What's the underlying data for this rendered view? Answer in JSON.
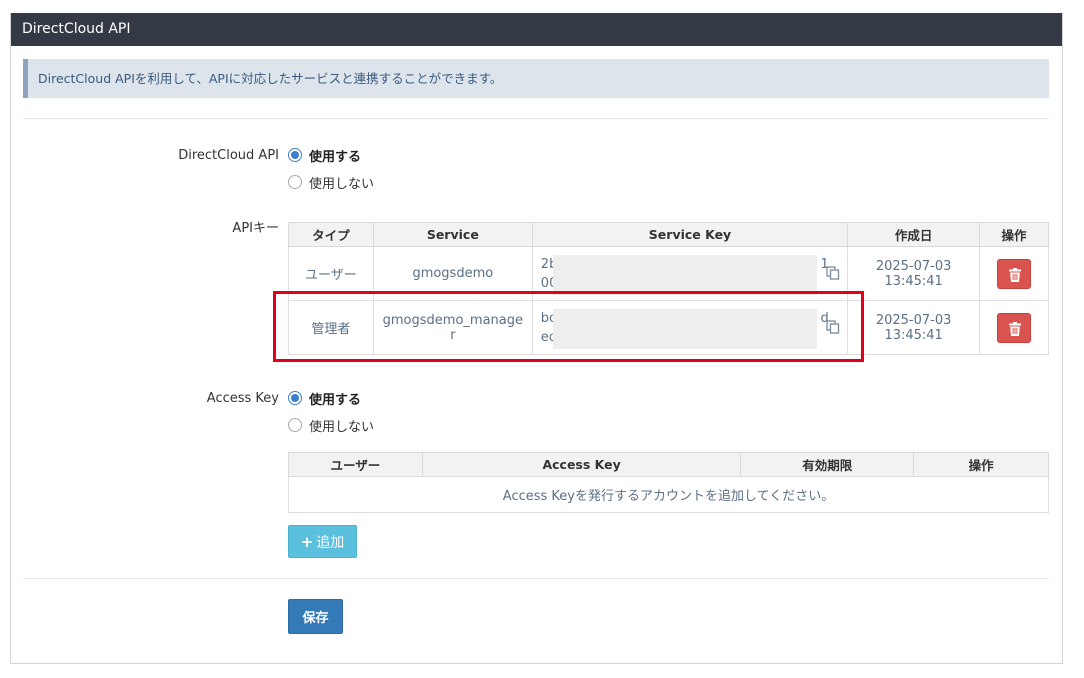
{
  "panel": {
    "title": "DirectCloud API"
  },
  "info": {
    "text": "DirectCloud APIを利用して、APIに対応したサービスと連携することができます。"
  },
  "directcloud_api": {
    "label": "DirectCloud API",
    "options": [
      {
        "label": "使用する",
        "checked": true
      },
      {
        "label": "使用しない",
        "checked": false
      }
    ]
  },
  "api_keys": {
    "label": "APIキー",
    "columns": [
      "タイプ",
      "Service",
      "Service Key",
      "作成日",
      "操作"
    ],
    "rows": [
      {
        "type": "ユーザー",
        "service": "gmogsdemo",
        "key_start": "2b",
        "key_end": "1",
        "key_start2": "00",
        "date": "2025-07-03",
        "time": "13:45:41"
      },
      {
        "type": "管理者",
        "service_line1": "gmogsdemo_manage",
        "service_line2": "r",
        "key_start": "bc",
        "key_end": "d",
        "key_start2": "ec",
        "date": "2025-07-03",
        "time": "13:45:41"
      }
    ]
  },
  "access_key": {
    "label": "Access Key",
    "options": [
      {
        "label": "使用する",
        "checked": true
      },
      {
        "label": "使用しない",
        "checked": false
      }
    ],
    "columns": [
      "ユーザー",
      "Access Key",
      "有効期限",
      "操作"
    ],
    "empty_message": "Access Keyを発行するアカウントを追加してください。",
    "add_label": "追加",
    "add_icon": "plus-icon"
  },
  "footer": {
    "save_label": "保存"
  },
  "colors": {
    "header_bg": "#343a45",
    "danger": "#d9534f",
    "info": "#5bc0de",
    "primary": "#337ab7",
    "highlight": "#e2001a"
  }
}
